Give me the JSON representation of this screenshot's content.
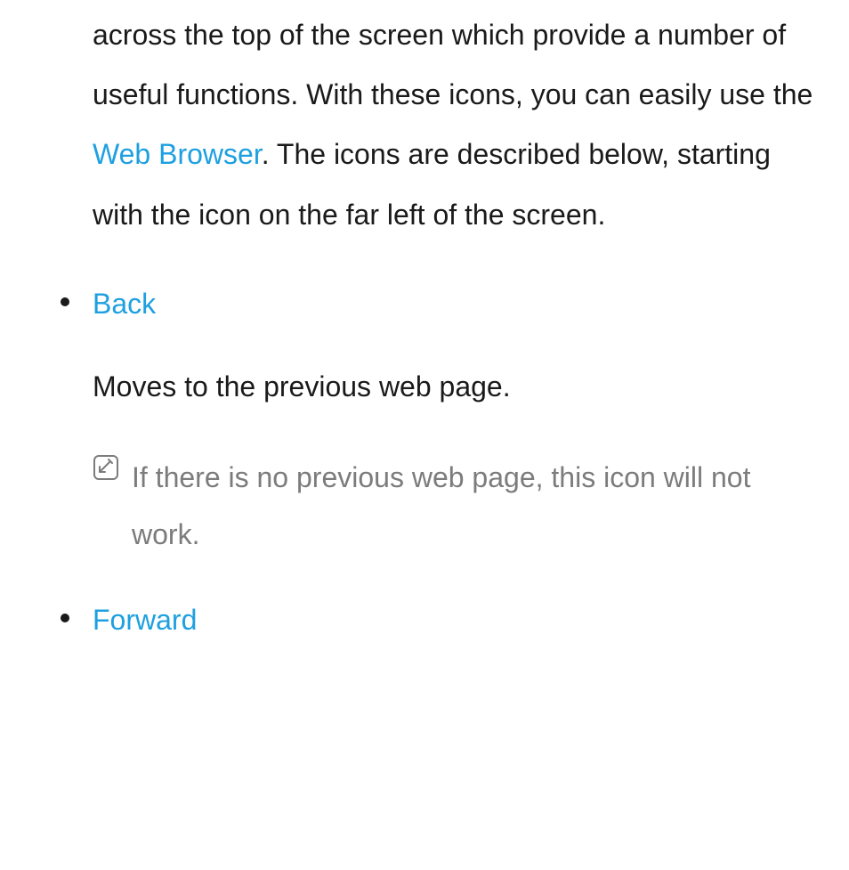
{
  "intro": {
    "part1": "across the top of the screen which provide a number of useful functions. With these icons, you can easily use the ",
    "link": "Web Browser",
    "part2": ". The icons are described below, starting with the icon on the far left of the screen."
  },
  "items": [
    {
      "title": "Back",
      "desc": "Moves to the previous web page.",
      "note": "If there is no previous web page, this icon will not work."
    },
    {
      "title": "Forward"
    }
  ],
  "colors": {
    "link": "#1ea0e0",
    "body": "#1a1a1a",
    "note": "#7c7c7c"
  }
}
